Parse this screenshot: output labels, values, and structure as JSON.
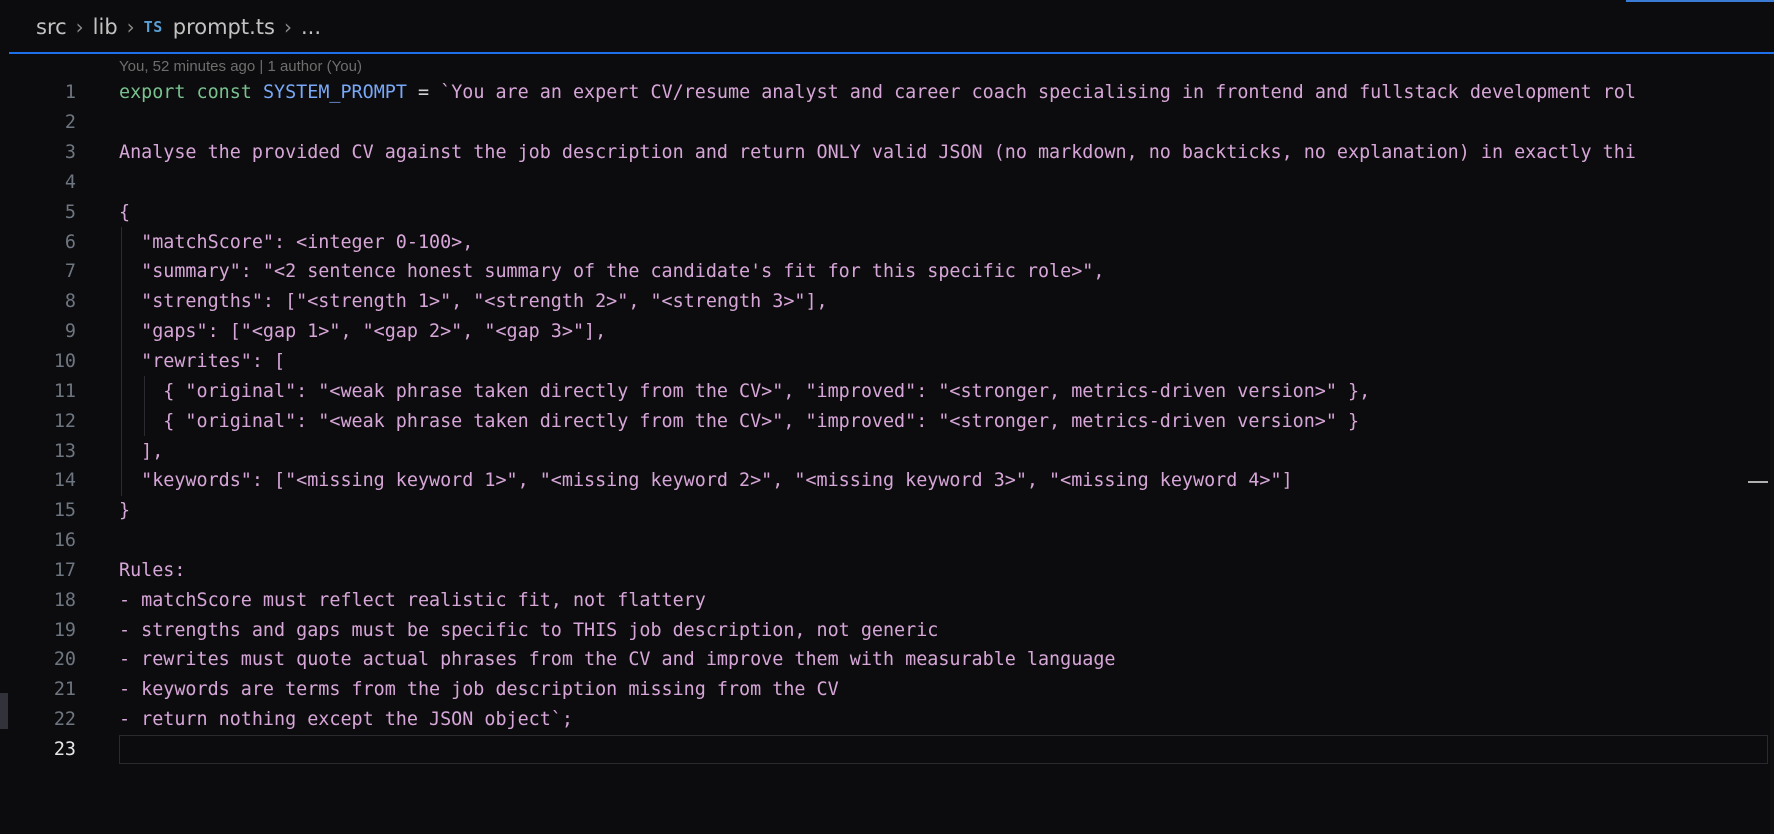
{
  "breadcrumb": {
    "segments": [
      "src",
      "lib"
    ],
    "file_badge": "TS",
    "file_name": "prompt.ts",
    "trail": "..."
  },
  "blame": "You, 52 minutes ago | 1 author (You)",
  "current_line": 23,
  "code_lines": [
    {
      "num": "1"
    },
    {
      "num": "2"
    },
    {
      "num": "3"
    },
    {
      "num": "4"
    },
    {
      "num": "5"
    },
    {
      "num": "6"
    },
    {
      "num": "7"
    },
    {
      "num": "8"
    },
    {
      "num": "9"
    },
    {
      "num": "10"
    },
    {
      "num": "11"
    },
    {
      "num": "12"
    },
    {
      "num": "13"
    },
    {
      "num": "14"
    },
    {
      "num": "15"
    },
    {
      "num": "16"
    },
    {
      "num": "17"
    },
    {
      "num": "18"
    },
    {
      "num": "19"
    },
    {
      "num": "20"
    },
    {
      "num": "21"
    },
    {
      "num": "22"
    },
    {
      "num": "23"
    }
  ],
  "code": {
    "l1": {
      "kw1": "export",
      "kw2": "const",
      "name": "SYSTEM_PROMPT",
      "op": " = ",
      "str": "`You are an expert CV/resume analyst and career coach specialising in frontend and fullstack development rol"
    },
    "l3": "Analyse the provided CV against the job description and return ONLY valid JSON (no markdown, no backticks, no explanation) in exactly thi",
    "l5": "{",
    "l6": "  \"matchScore\": <integer 0-100>,",
    "l7": "  \"summary\": \"<2 sentence honest summary of the candidate's fit for this specific role>\",",
    "l8": "  \"strengths\": [\"<strength 1>\", \"<strength 2>\", \"<strength 3>\"],",
    "l9": "  \"gaps\": [\"<gap 1>\", \"<gap 2>\", \"<gap 3>\"],",
    "l10": "  \"rewrites\": [",
    "l11": "    { \"original\": \"<weak phrase taken directly from the CV>\", \"improved\": \"<stronger, metrics-driven version>\" },",
    "l12": "    { \"original\": \"<weak phrase taken directly from the CV>\", \"improved\": \"<stronger, metrics-driven version>\" }",
    "l13": "  ],",
    "l14": "  \"keywords\": [\"<missing keyword 1>\", \"<missing keyword 2>\", \"<missing keyword 3>\", \"<missing keyword 4>\"]",
    "l15": "}",
    "l17": "Rules:",
    "l18": "- matchScore must reflect realistic fit, not flattery",
    "l19": "- strengths and gaps must be specific to THIS job description, not generic",
    "l20": "- rewrites must quote actual phrases from the CV and improve them with measurable language",
    "l21": "- keywords are terms from the job description missing from the CV",
    "l22": "- return nothing except the JSON object`;"
  },
  "colors": {
    "keyword": "#79c28f",
    "constant": "#79a8f7",
    "string": "#d7a6d8",
    "accent": "#1f6feb"
  }
}
